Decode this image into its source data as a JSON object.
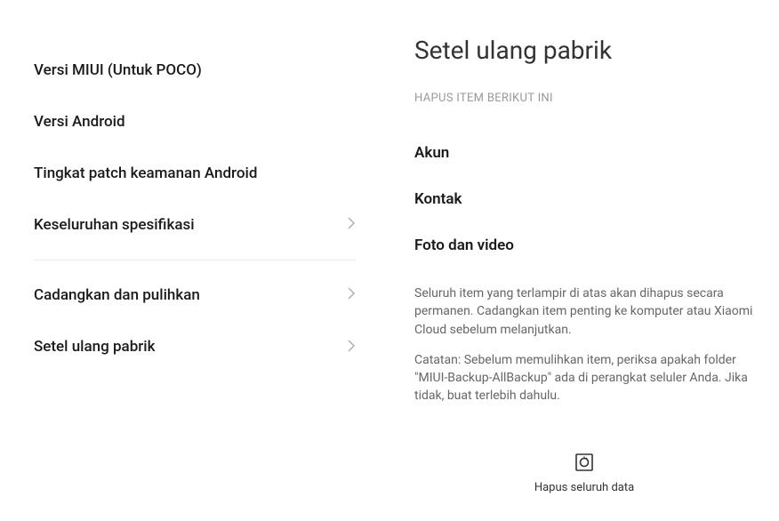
{
  "left": {
    "items": [
      {
        "label": "Versi MIUI (Untuk POCO)",
        "chevron": false
      },
      {
        "label": "Versi Android",
        "chevron": false
      },
      {
        "label": "Tingkat patch keamanan Android",
        "chevron": false
      },
      {
        "label": "Keseluruhan spesifikasi",
        "chevron": true
      },
      {
        "divider": true
      },
      {
        "label": "Cadangkan dan pulihkan",
        "chevron": true
      },
      {
        "label": "Setel ulang pabrik",
        "chevron": true
      }
    ]
  },
  "right": {
    "title": "Setel ulang pabrik",
    "subtitle": "HAPUS ITEM BERIKUT INI",
    "items": [
      "Akun",
      "Kontak",
      "Foto dan video"
    ],
    "paragraph1": "Seluruh item yang terlampir di atas akan dihapus secara permanen. Cadangkan item penting ke komputer atau Xiaomi Cloud sebelum melanjutkan.",
    "paragraph2": "Catatan: Sebelum memulihkan item, periksa apakah folder \"MIUI-Backup-AllBackup\" ada di perangkat seluler Anda. Jika tidak, buat terlebih dahulu.",
    "action_label": "Hapus seluruh data"
  }
}
